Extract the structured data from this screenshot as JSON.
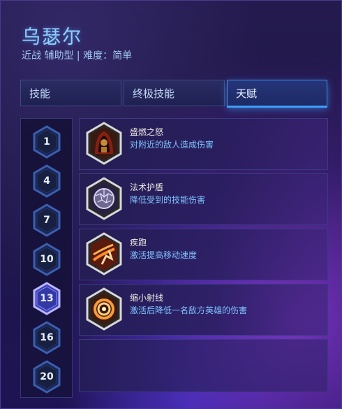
{
  "hero": {
    "name": "乌瑟尔",
    "subtitle": "近战 辅助型 | 难度：简单"
  },
  "tabs": [
    {
      "label": "技能",
      "active": false
    },
    {
      "label": "终极技能",
      "active": false
    },
    {
      "label": "天赋",
      "active": true
    }
  ],
  "levels": [
    {
      "label": "1",
      "selected": false
    },
    {
      "label": "4",
      "selected": false
    },
    {
      "label": "7",
      "selected": false
    },
    {
      "label": "10",
      "selected": false
    },
    {
      "label": "13",
      "selected": true
    },
    {
      "label": "16",
      "selected": false
    },
    {
      "label": "20",
      "selected": false
    }
  ],
  "talents": [
    {
      "name": "盛燃之怒",
      "description": "对附近的敌人造成伤害",
      "icon": "hooded-figure-icon"
    },
    {
      "name": "法术护盾",
      "description": "降低受到的技能伤害",
      "icon": "arcane-orb-icon"
    },
    {
      "name": "疾跑",
      "description": "激活提高移动速度",
      "icon": "sprint-icon"
    },
    {
      "name": "缩小射线",
      "description": "激活后降低一名敌方英雄的伤害",
      "icon": "shrink-ray-icon"
    }
  ],
  "colors": {
    "accent": "#3aa2ff",
    "hero_name": "#8fd0ff",
    "talent_desc": "#7fc3ff",
    "selected_glow": "#8a8cff"
  }
}
